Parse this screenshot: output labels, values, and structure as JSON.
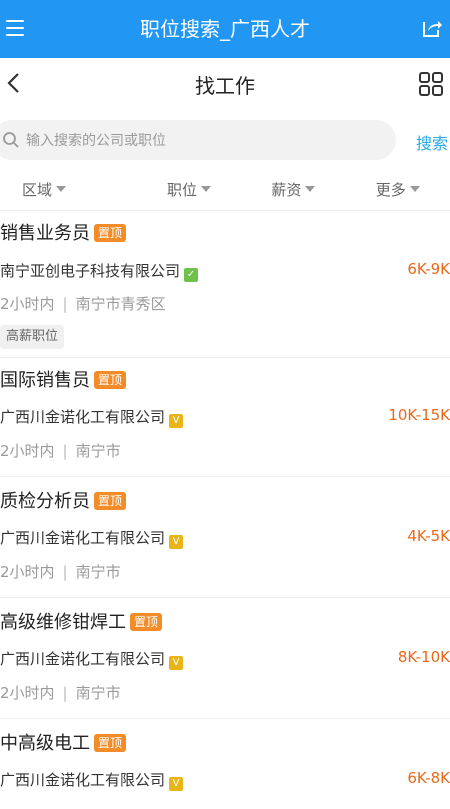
{
  "app": {
    "title": "职位搜索_广西人才"
  },
  "nav": {
    "title": "找工作"
  },
  "search": {
    "placeholder": "输入搜索的公司或职位",
    "button_label": "搜索"
  },
  "filters": [
    {
      "label": "区域"
    },
    {
      "label": "职位"
    },
    {
      "label": "薪资"
    },
    {
      "label": "更多"
    }
  ],
  "jobs": [
    {
      "title": "销售业务员",
      "tag": "置顶",
      "company": "南宁亚创电子科技有限公司",
      "verify": "green",
      "salary": "6K-9K",
      "time": "2小时内",
      "location": "南宁市青秀区",
      "highlight": "高薪职位"
    },
    {
      "title": "国际销售员",
      "tag": "置顶",
      "company": "广西川金诺化工有限公司",
      "verify": "yellow",
      "salary": "10K-15K",
      "time": "2小时内",
      "location": "南宁市"
    },
    {
      "title": "质检分析员",
      "tag": "置顶",
      "company": "广西川金诺化工有限公司",
      "verify": "yellow",
      "salary": "4K-5K",
      "time": "2小时内",
      "location": "南宁市"
    },
    {
      "title": "高级维修钳焊工",
      "tag": "置顶",
      "company": "广西川金诺化工有限公司",
      "verify": "yellow",
      "salary": "8K-10K",
      "time": "2小时内",
      "location": "南宁市"
    },
    {
      "title": "中高级电工",
      "tag": "置顶",
      "company": "广西川金诺化工有限公司",
      "verify": "yellow",
      "salary": "6K-8K",
      "time": "",
      "location": ""
    }
  ],
  "colors": {
    "header_bg": "#2196F3",
    "accent": "#27a9e1",
    "salary": "#e8691a",
    "tag_top": "#f28c28"
  }
}
